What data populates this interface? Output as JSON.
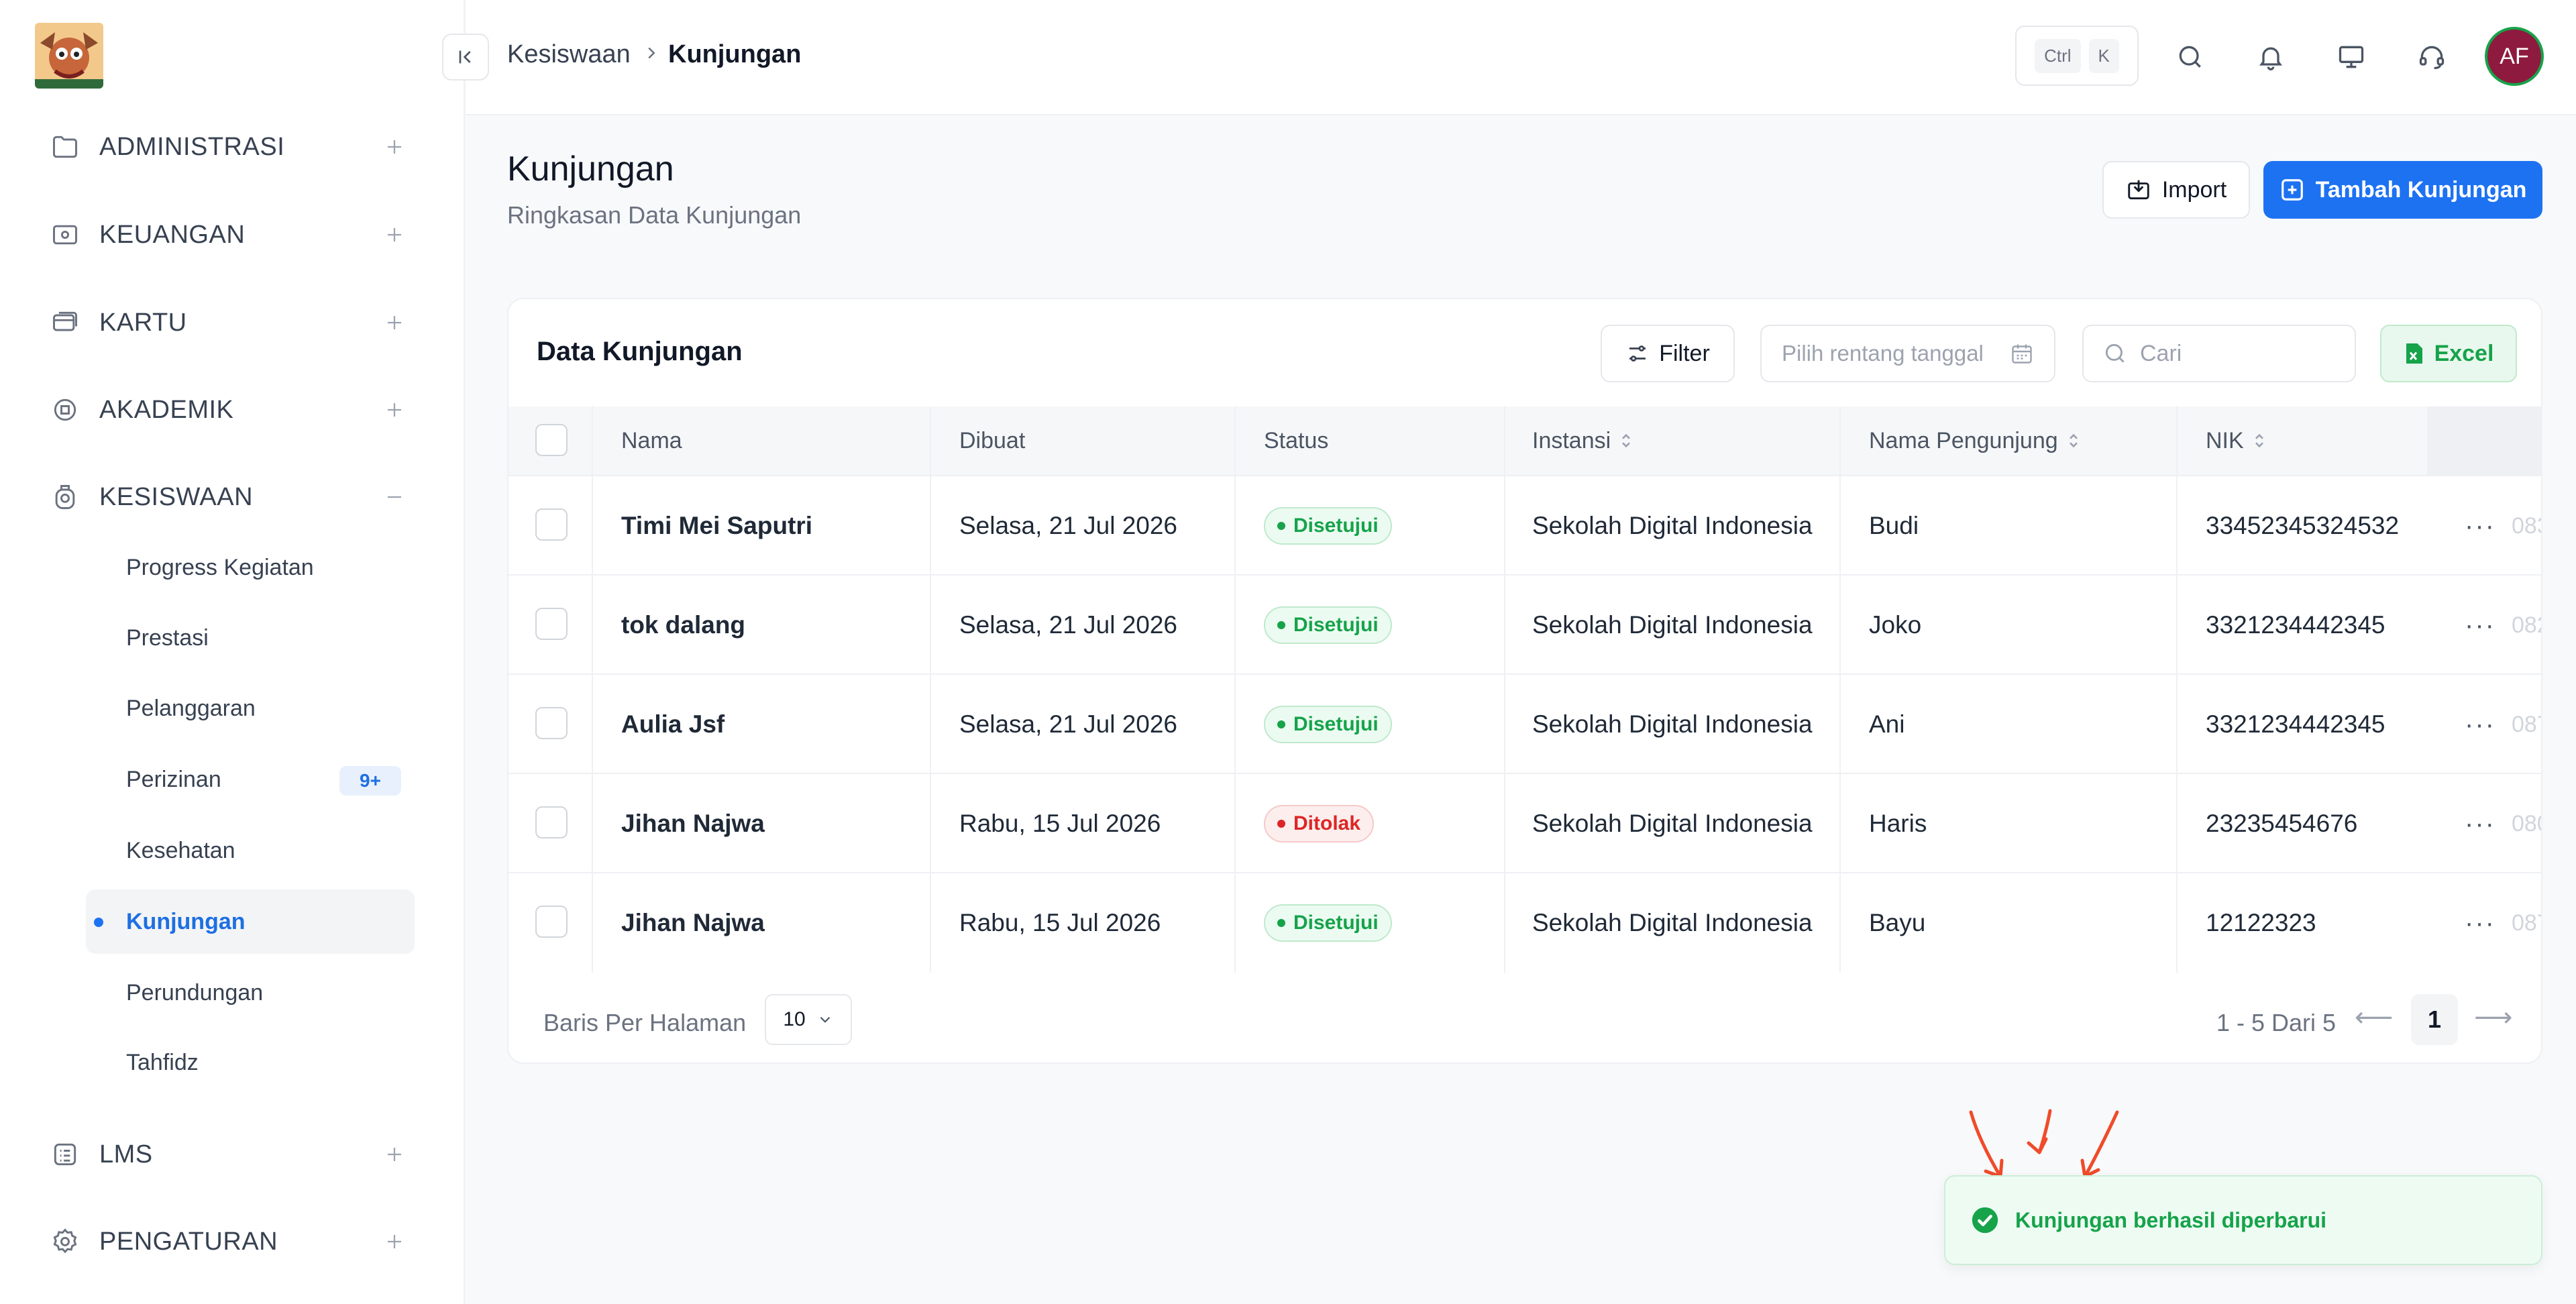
{
  "sidebar": {
    "nav": [
      {
        "label": "ADMINISTRASI",
        "icon": "folder-icon",
        "toggle": "plus"
      },
      {
        "label": "KEUANGAN",
        "icon": "money-icon",
        "toggle": "plus"
      },
      {
        "label": "KARTU",
        "icon": "card-icon",
        "toggle": "plus"
      },
      {
        "label": "AKADEMIK",
        "icon": "academic-icon",
        "toggle": "plus"
      },
      {
        "label": "KESISWAAN",
        "icon": "student-icon",
        "toggle": "minus"
      },
      {
        "label": "LMS",
        "icon": "checklist-icon",
        "toggle": "plus"
      },
      {
        "label": "PENGATURAN",
        "icon": "gear-icon",
        "toggle": "plus"
      }
    ],
    "sub": [
      {
        "label": "Progress Kegiatan"
      },
      {
        "label": "Prestasi"
      },
      {
        "label": "Pelanggaran"
      },
      {
        "label": "Perizinan",
        "badge": "9+"
      },
      {
        "label": "Kesehatan"
      },
      {
        "label": "Kunjungan",
        "active": true
      },
      {
        "label": "Perundungan"
      },
      {
        "label": "Tahfidz"
      }
    ]
  },
  "topbar": {
    "breadcrumb": [
      "Kesiswaan",
      "Kunjungan"
    ],
    "kbd": [
      "Ctrl",
      "K"
    ],
    "avatar": "AF"
  },
  "page": {
    "title": "Kunjungan",
    "subtitle": "Ringkasan Data Kunjungan",
    "import_label": "Import",
    "add_label": "Tambah Kunjungan"
  },
  "card": {
    "title": "Data Kunjungan",
    "filter_label": "Filter",
    "date_placeholder": "Pilih rentang tanggal",
    "search_placeholder": "Cari",
    "excel_label": "Excel",
    "columns": [
      "Nama",
      "Dibuat",
      "Status",
      "Instansi",
      "Nama Pengunjung",
      "NIK"
    ],
    "rows": [
      {
        "nama": "Timi Mei Saputri",
        "dibuat": "Selasa, 21 Jul 2026",
        "status": "Disetujui",
        "status_type": "ok",
        "instansi": "Sekolah Digital Indonesia",
        "pengunjung": "Budi",
        "nik": "33452345324532",
        "cut": "083"
      },
      {
        "nama": "tok dalang",
        "dibuat": "Selasa, 21 Jul 2026",
        "status": "Disetujui",
        "status_type": "ok",
        "instansi": "Sekolah Digital Indonesia",
        "pengunjung": "Joko",
        "nik": "3321234442345",
        "cut": "082"
      },
      {
        "nama": "Aulia Jsf",
        "dibuat": "Selasa, 21 Jul 2026",
        "status": "Disetujui",
        "status_type": "ok",
        "instansi": "Sekolah Digital Indonesia",
        "pengunjung": "Ani",
        "nik": "3321234442345",
        "cut": "087"
      },
      {
        "nama": "Jihan Najwa",
        "dibuat": "Rabu, 15 Jul 2026",
        "status": "Ditolak",
        "status_type": "no",
        "instansi": "Sekolah Digital Indonesia",
        "pengunjung": "Haris",
        "nik": "23235454676",
        "cut": "080"
      },
      {
        "nama": "Jihan Najwa",
        "dibuat": "Rabu, 15 Jul 2026",
        "status": "Disetujui",
        "status_type": "ok",
        "instansi": "Sekolah Digital Indonesia",
        "pengunjung": "Bayu",
        "nik": "12122323",
        "cut": "087"
      }
    ],
    "per_page_label": "Baris Per Halaman",
    "per_page_value": "10",
    "range_text": "1 - 5 Dari 5",
    "page": "1"
  },
  "toast": {
    "message": "Kunjungan berhasil diperbarui"
  },
  "colors": {
    "accent": "#1d72f2",
    "success": "#16a34a",
    "danger": "#dc2626",
    "avatar_bg": "#8e1a3f"
  }
}
